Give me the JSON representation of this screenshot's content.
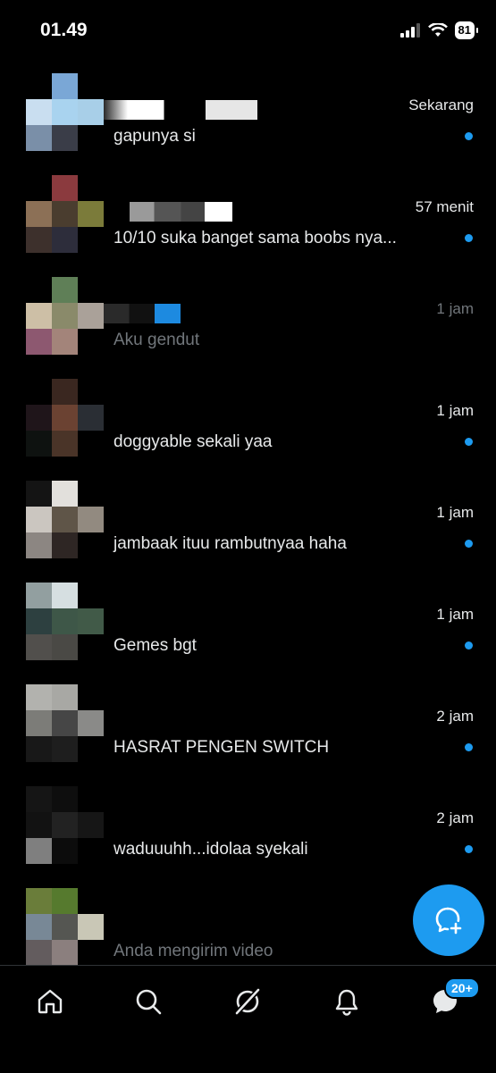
{
  "status_bar": {
    "time": "01.49",
    "battery": "81"
  },
  "conversations": [
    {
      "time": "Sekarang",
      "preview": "gapunya si",
      "unread": true,
      "avatar": [
        "",
        "#7aa7d6",
        "",
        "#c9def0",
        "#a9d3ef",
        "#a8cfe8",
        "#7a8fa8",
        "#3a3d48",
        ""
      ]
    },
    {
      "time": "57 menit",
      "preview": "10/10 suka banget sama boobs nya...",
      "unread": true,
      "avatar": [
        "",
        "#8b3a3e",
        "",
        "#8c7056",
        "#4a3d2f",
        "#7b7b3a",
        "#3d302c",
        "#2d2d3b",
        ""
      ]
    },
    {
      "time": "1 jam",
      "preview": "Aku gendut",
      "unread": false,
      "avatar": [
        "",
        "#5f7f57",
        "",
        "#cdbfa6",
        "#8a8a6a",
        "#aaa199",
        "#8d5870",
        "#a3847a",
        ""
      ]
    },
    {
      "time": "1 jam",
      "preview": "doggyable sekali yaa",
      "unread": true,
      "avatar": [
        "",
        "#3a2720",
        "",
        "#1f151a",
        "#6b4232",
        "#2a2e34",
        "#0e1210",
        "#4a3428",
        ""
      ]
    },
    {
      "time": "1 jam",
      "preview": "jambaak ituu rambutnyaa haha",
      "unread": true,
      "avatar": [
        "#141414",
        "#e2e0dc",
        "",
        "#cbc6c0",
        "#5f5548",
        "#928a80",
        "#8c8682",
        "#2e2624",
        ""
      ]
    },
    {
      "time": "1 jam",
      "preview": "Gemes bgt",
      "unread": true,
      "avatar": [
        "#929fa0",
        "#d6dfe1",
        "",
        "#2d4040",
        "#3e5748",
        "#415a48",
        "#514f4c",
        "#4a4945",
        ""
      ]
    },
    {
      "time": "2 jam",
      "preview": "HASRAT PENGEN SWITCH",
      "unread": true,
      "avatar": [
        "#b2b2ae",
        "#a8a8a4",
        "",
        "#7c7c78",
        "#464646",
        "#8a8a88",
        "#181818",
        "#1e1e1e",
        ""
      ]
    },
    {
      "time": "2 jam",
      "preview": "waduuuhh...idolaa syekali",
      "unread": true,
      "avatar": [
        "#151515",
        "#0e0e0e",
        "",
        "#121212",
        "#222222",
        "#161616",
        "#7f7f7f",
        "#0c0c0c",
        ""
      ]
    },
    {
      "time": "",
      "preview": "Anda mengirim video",
      "unread": false,
      "avatar": [
        "#6a7d3a",
        "#567a2e",
        "",
        "#788896",
        "#555652",
        "#c9c7b6",
        "#635c5e",
        "#8b7f7e",
        ""
      ]
    }
  ],
  "fab": {
    "icon": "new-message-icon"
  },
  "nav": {
    "items": [
      "home-icon",
      "search-icon",
      "grok-icon",
      "notifications-icon",
      "messages-icon"
    ],
    "messages_badge": "20+"
  },
  "colors": {
    "accent": "#1d9bf0",
    "muted": "#71767b",
    "text": "#e7e9ea",
    "divider": "#2f3336"
  }
}
